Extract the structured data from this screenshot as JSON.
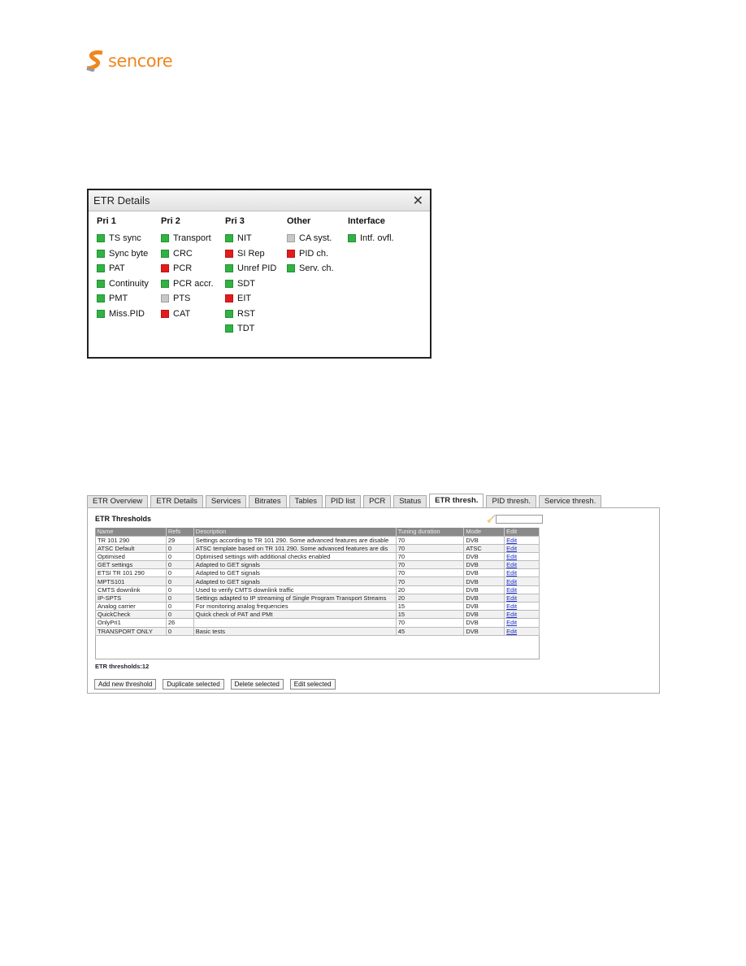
{
  "logo": {
    "text": "sencore",
    "color": "#f0861e"
  },
  "etr_details": {
    "title": "ETR Details",
    "colors": {
      "ok": "#2fb342",
      "error": "#e51b1b",
      "disabled": "#c8c8c8"
    },
    "columns": [
      {
        "header": "Pri 1",
        "items": [
          {
            "label": "TS sync",
            "status": "ok"
          },
          {
            "label": "Sync byte",
            "status": "ok"
          },
          {
            "label": "PAT",
            "status": "ok"
          },
          {
            "label": "Continuity",
            "status": "ok"
          },
          {
            "label": "PMT",
            "status": "ok"
          },
          {
            "label": "Miss.PID",
            "status": "ok"
          }
        ]
      },
      {
        "header": "Pri 2",
        "items": [
          {
            "label": "Transport",
            "status": "ok"
          },
          {
            "label": "CRC",
            "status": "ok"
          },
          {
            "label": "PCR",
            "status": "error"
          },
          {
            "label": "PCR accr.",
            "status": "ok"
          },
          {
            "label": "PTS",
            "status": "disabled"
          },
          {
            "label": "CAT",
            "status": "error"
          }
        ]
      },
      {
        "header": "Pri 3",
        "items": [
          {
            "label": "NIT",
            "status": "ok"
          },
          {
            "label": "SI Rep",
            "status": "error"
          },
          {
            "label": "Unref PID",
            "status": "ok"
          },
          {
            "label": "SDT",
            "status": "ok"
          },
          {
            "label": "EIT",
            "status": "error"
          },
          {
            "label": "RST",
            "status": "ok"
          },
          {
            "label": "TDT",
            "status": "ok"
          }
        ]
      },
      {
        "header": "Other",
        "items": [
          {
            "label": "CA syst.",
            "status": "disabled"
          },
          {
            "label": "PID ch.",
            "status": "error"
          },
          {
            "label": "Serv. ch.",
            "status": "ok"
          }
        ]
      },
      {
        "header": "Interface",
        "items": [
          {
            "label": "Intf. ovfl.",
            "status": "ok"
          }
        ]
      }
    ]
  },
  "thresholds": {
    "tabs": [
      "ETR Overview",
      "ETR Details",
      "Services",
      "Bitrates",
      "Tables",
      "PID list",
      "PCR",
      "Status",
      "ETR thresh.",
      "PID thresh.",
      "Service thresh."
    ],
    "active_tab": "ETR thresh.",
    "title": "ETR Thresholds",
    "filter_value": "",
    "columns": [
      "Name",
      "Refs",
      "Description",
      "Tuning duration",
      "Mode",
      "Edit"
    ],
    "rows": [
      [
        "TR 101 290",
        "29",
        "Settings according to TR 101 290. Some advanced features are disable",
        "70",
        "DVB",
        "Edit"
      ],
      [
        "ATSC Default",
        "0",
        "ATSC template based on TR 101 290. Some advanced features are dis",
        "70",
        "ATSC",
        "Edit"
      ],
      [
        "Optimised",
        "0",
        "Optimised settings with additional checks enabled",
        "70",
        "DVB",
        "Edit"
      ],
      [
        "GET settings",
        "0",
        "Adapted to GET signals",
        "70",
        "DVB",
        "Edit"
      ],
      [
        "ETSI TR 101 290",
        "0",
        "Adapted to GET signals",
        "70",
        "DVB",
        "Edit"
      ],
      [
        "MPTS101",
        "0",
        "Adapted to GET signals",
        "70",
        "DVB",
        "Edit"
      ],
      [
        "CMTS downlink",
        "0",
        "Used to verify CMTS downlink traffic",
        "20",
        "DVB",
        "Edit"
      ],
      [
        "IP-SPTS",
        "0",
        "Settings adapted to IP streaming of Single Program Transport Streams",
        "20",
        "DVB",
        "Edit"
      ],
      [
        "Analog carrier",
        "0",
        "For monitoring analog frequencies",
        "15",
        "DVB",
        "Edit"
      ],
      [
        "QuickCheck",
        "0",
        "Quick check of PAT and PMt",
        "15",
        "DVB",
        "Edit"
      ],
      [
        "OnlyPri1",
        "26",
        "",
        "70",
        "DVB",
        "Edit"
      ],
      [
        "TRANSPORT ONLY",
        "0",
        "Basic tests",
        "45",
        "DVB",
        "Edit"
      ]
    ],
    "count_label": "ETR thresholds:12",
    "buttons": [
      "Add new threshold",
      "Duplicate selected",
      "Delete selected",
      "Edit selected"
    ]
  }
}
